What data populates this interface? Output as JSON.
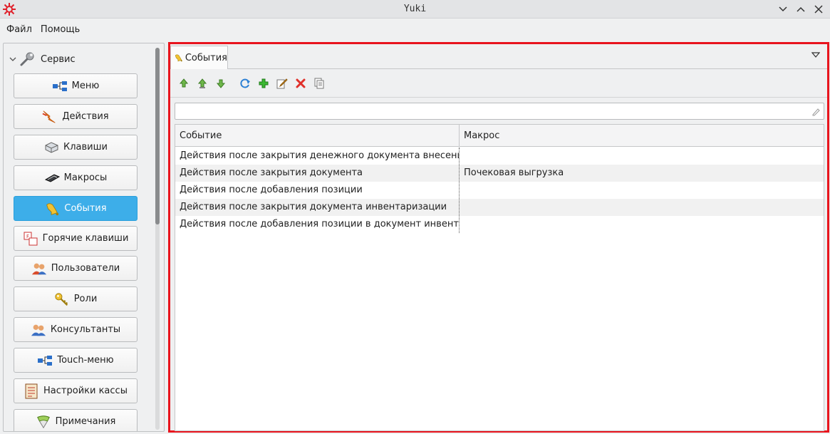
{
  "window": {
    "title": "Yuki"
  },
  "menu": {
    "items": [
      "Файл",
      "Помощь"
    ]
  },
  "sidebar": {
    "section": "Сервис",
    "items": [
      {
        "label": "Меню",
        "icon": "menu-tree-icon"
      },
      {
        "label": "Действия",
        "icon": "action-arrow-icon"
      },
      {
        "label": "Клавиши",
        "icon": "keyboard-key-icon"
      },
      {
        "label": "Макросы",
        "icon": "macro-icon"
      },
      {
        "label": "События",
        "icon": "bell-icon",
        "active": true
      },
      {
        "label": "Горячие клавиши",
        "icon": "hotkeys-icon"
      },
      {
        "label": "Пользователи",
        "icon": "users-icon"
      },
      {
        "label": "Роли",
        "icon": "key-icon"
      },
      {
        "label": "Консультанты",
        "icon": "consultants-icon"
      },
      {
        "label": "Touch-меню",
        "icon": "touch-menu-icon"
      },
      {
        "label": "Настройки кассы",
        "icon": "settings-doc-icon"
      },
      {
        "label": "Примечания",
        "icon": "notes-icon"
      }
    ]
  },
  "main": {
    "tab_label": "События",
    "table": {
      "columns": [
        "Событие",
        "Макрос"
      ],
      "rows": [
        [
          "Действия после закрытия денежного документа внесения/изъятия",
          ""
        ],
        [
          "Действия после закрытия документа",
          "Почековая выгрузка"
        ],
        [
          "Действия после добавления позиции",
          ""
        ],
        [
          "Действия после закрытия документа инвентаризации",
          ""
        ],
        [
          "Действия после добавления позиции в документ инвентаризации",
          ""
        ]
      ]
    }
  },
  "colors": {
    "accent": "#3daee9",
    "highlight_border": "#e8141d"
  }
}
